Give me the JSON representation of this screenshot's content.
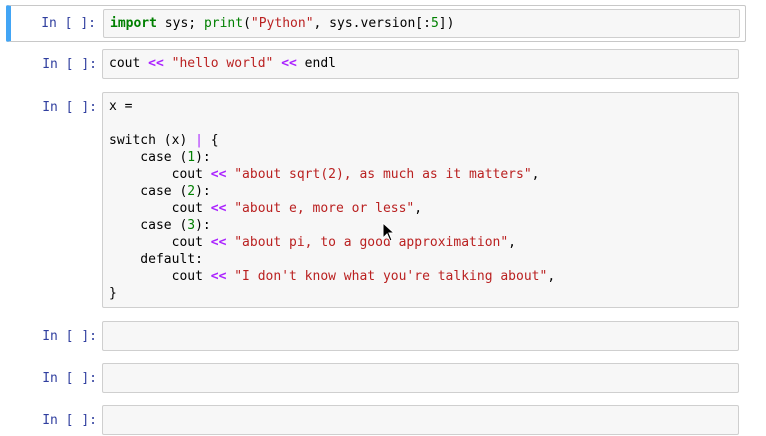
{
  "cells": [
    {
      "prompt": "In [ ]:",
      "lines": [
        [
          [
            "kw",
            "import"
          ],
          [
            "t",
            " sys; "
          ],
          [
            "fn",
            "print"
          ],
          [
            "t",
            "("
          ],
          [
            "str",
            "\"Python\""
          ],
          [
            "t",
            ", sys.version[:"
          ],
          [
            "num",
            "5"
          ],
          [
            "t",
            "])"
          ]
        ]
      ]
    },
    {
      "prompt": "In [ ]:",
      "lines": [
        [
          [
            "t",
            "cout "
          ],
          [
            "op",
            "<<"
          ],
          [
            "t",
            " "
          ],
          [
            "str",
            "\"hello world\""
          ],
          [
            "t",
            " "
          ],
          [
            "op",
            "<<"
          ],
          [
            "t",
            " endl"
          ]
        ]
      ]
    },
    {
      "prompt": "In [ ]:",
      "lines": [
        [
          [
            "t",
            "x ="
          ]
        ],
        [],
        [
          [
            "t",
            "switch (x) "
          ],
          [
            "cur",
            "|"
          ],
          [
            "t",
            " {"
          ]
        ],
        [
          [
            "t",
            "    case ("
          ],
          [
            "num",
            "1"
          ],
          [
            "t",
            "):"
          ]
        ],
        [
          [
            "t",
            "        cout "
          ],
          [
            "op",
            "<<"
          ],
          [
            "t",
            " "
          ],
          [
            "str",
            "\"about sqrt(2), as much as it matters\""
          ],
          [
            "t",
            ","
          ]
        ],
        [
          [
            "t",
            "    case ("
          ],
          [
            "num",
            "2"
          ],
          [
            "t",
            "):"
          ]
        ],
        [
          [
            "t",
            "        cout "
          ],
          [
            "op",
            "<<"
          ],
          [
            "t",
            " "
          ],
          [
            "str",
            "\"about e, more or less\""
          ],
          [
            "t",
            ","
          ]
        ],
        [
          [
            "t",
            "    case ("
          ],
          [
            "num",
            "3"
          ],
          [
            "t",
            "):"
          ]
        ],
        [
          [
            "t",
            "        cout "
          ],
          [
            "op",
            "<<"
          ],
          [
            "t",
            " "
          ],
          [
            "str",
            "\"about pi, to a good approximation\""
          ],
          [
            "t",
            ","
          ]
        ],
        [
          [
            "t",
            "    default:"
          ]
        ],
        [
          [
            "t",
            "        cout "
          ],
          [
            "op",
            "<<"
          ],
          [
            "t",
            " "
          ],
          [
            "str",
            "\"I don't know what you're talking about\""
          ],
          [
            "t",
            ","
          ]
        ],
        [
          [
            "t",
            "}"
          ]
        ]
      ]
    },
    {
      "prompt": "In [ ]:",
      "lines": []
    },
    {
      "prompt": "In [ ]:",
      "lines": []
    },
    {
      "prompt": "In [ ]:",
      "lines": []
    }
  ]
}
